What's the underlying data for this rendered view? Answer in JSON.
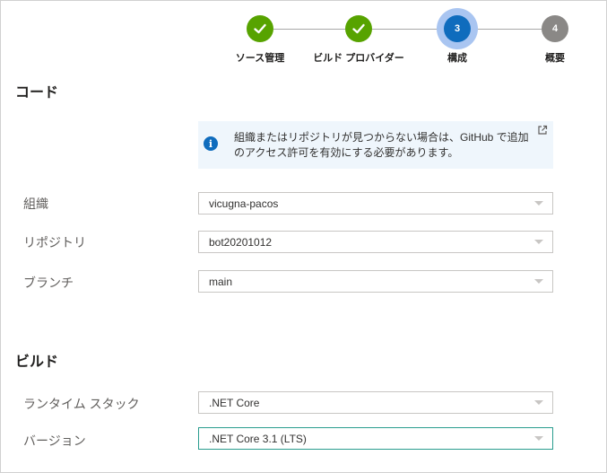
{
  "stepper": {
    "steps": [
      {
        "label": "ソース管理",
        "status": "done",
        "number": ""
      },
      {
        "label": "ビルド プロバイダー",
        "status": "done",
        "number": ""
      },
      {
        "label": "構成",
        "status": "current",
        "number": "3"
      },
      {
        "label": "概要",
        "status": "todo",
        "number": "4"
      }
    ]
  },
  "code_section": {
    "title": "コード",
    "info_message": "組織またはリポジトリが見つからない場合は、GitHub で追加のアクセス許可を有効にする必要があります。",
    "fields": [
      {
        "label": "組織",
        "value": "vicugna-pacos"
      },
      {
        "label": "リポジトリ",
        "value": "bot20201012"
      },
      {
        "label": "ブランチ",
        "value": "main"
      }
    ]
  },
  "build_section": {
    "title": "ビルド",
    "fields": [
      {
        "label": "ランタイム スタック",
        "value": ".NET Core"
      },
      {
        "label": "バージョン",
        "value": ".NET Core 3.1 (LTS)"
      }
    ]
  },
  "colors": {
    "done": "#57a300",
    "current": "#0f6cbd",
    "todo": "#8a8886",
    "info_bg": "#eff6fc"
  }
}
